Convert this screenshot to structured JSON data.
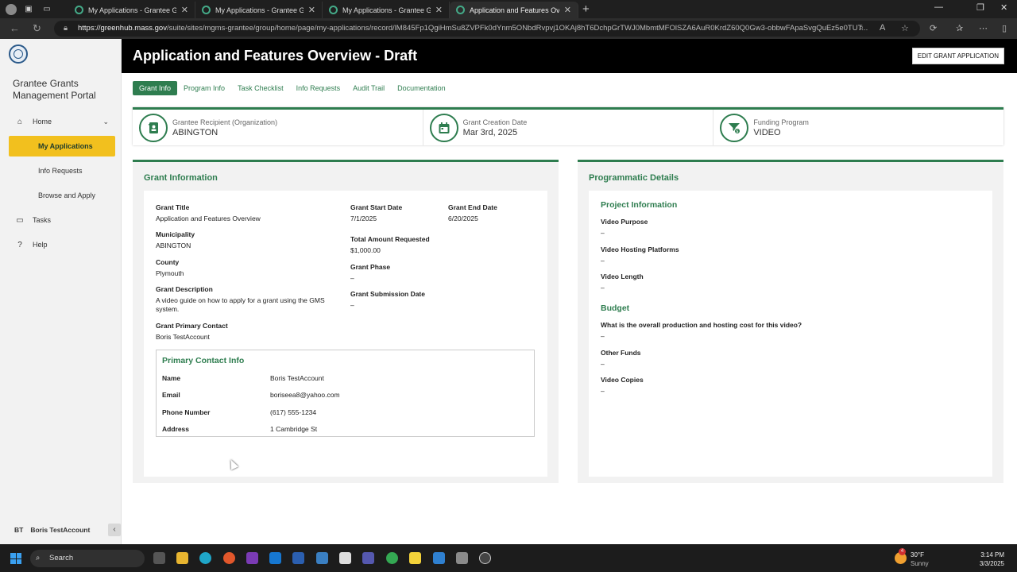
{
  "browser": {
    "tabs": [
      {
        "title": "My Applications - Grantee Grants"
      },
      {
        "title": "My Applications - Grantee Grants"
      },
      {
        "title": "My Applications - Grantee Grants"
      },
      {
        "title": "Application and Features Overview"
      }
    ],
    "url_host": "https://greenhub.mass.gov",
    "url_path": "/suite/sites/mgms-grantee/group/home/page/my-applications/record/lM845Fp1QgiHmSu8ZVPFk0dYnm5ONbdRvpvj1OKAj8hT6DchpGrTWJ0MbmtMFOlSZA6AuR0KrdZ60Q0Gw3-obbwFApaSvgQuEz5e0TUT..."
  },
  "sidebar": {
    "portal_title": "Grantee Grants Management Portal",
    "items": [
      {
        "label": "Home"
      },
      {
        "label": "My Applications"
      },
      {
        "label": "Info Requests"
      },
      {
        "label": "Browse and Apply"
      },
      {
        "label": "Tasks"
      },
      {
        "label": "Help"
      }
    ],
    "user_initials": "BT",
    "user_name": "Boris TestAccount"
  },
  "header": {
    "title": "Application and Features Overview - Draft",
    "edit_button": "EDIT GRANT APPLICATION"
  },
  "tabs": [
    "Grant Info",
    "Program Info",
    "Task Checklist",
    "Info Requests",
    "Audit Trail",
    "Documentation"
  ],
  "summary": {
    "recipient_label": "Grantee Recipient (Organization)",
    "recipient_value": "ABINGTON",
    "creation_label": "Grant Creation Date",
    "creation_value": "Mar 3rd, 2025",
    "program_label": "Funding Program",
    "program_value": "VIDEO"
  },
  "grant_info": {
    "heading": "Grant Information",
    "title_label": "Grant Title",
    "title_value": "Application and Features Overview",
    "municipality_label": "Municipality",
    "municipality_value": "ABINGTON",
    "county_label": "County",
    "county_value": "Plymouth",
    "description_label": "Grant Description",
    "description_value": "A video guide on how to apply for a grant using the GMS system.",
    "primary_contact_label": "Grant Primary Contact",
    "primary_contact_value": "Boris TestAccount",
    "start_label": "Grant Start Date",
    "start_value": "7/1/2025",
    "end_label": "Grant End Date",
    "end_value": "6/20/2025",
    "amount_label": "Total Amount Requested",
    "amount_value": "$1,000.00",
    "phase_label": "Grant Phase",
    "phase_value": "–",
    "submission_label": "Grant Submission Date",
    "submission_value": "–",
    "contact_box": {
      "title": "Primary Contact Info",
      "name_label": "Name",
      "name_value": "Boris TestAccount",
      "email_label": "Email",
      "email_value": "boriseea8@yahoo.com",
      "phone_label": "Phone Number",
      "phone_value": "(617) 555-1234",
      "address_label": "Address",
      "address_value": "1 Cambridge St"
    }
  },
  "programmatic": {
    "heading": "Programmatic Details",
    "project_heading": "Project Information",
    "purpose_label": "Video Purpose",
    "purpose_value": "–",
    "platforms_label": "Video Hosting Platforms",
    "platforms_value": "–",
    "length_label": "Video Length",
    "length_value": "–",
    "budget_heading": "Budget",
    "cost_label": "What is the overall production and hosting cost for this video?",
    "cost_value": "–",
    "other_funds_label": "Other Funds",
    "other_funds_value": "–",
    "copies_label": "Video Copies",
    "copies_value": "–"
  },
  "taskbar": {
    "search": "Search",
    "weather_temp": "30°F",
    "weather_desc": "Sunny",
    "time": "3:14 PM",
    "date": "3/3/2025",
    "notification_count": "4"
  },
  "colors": {
    "accent": "#2e7d4f",
    "highlight": "#f2c01e",
    "header": "#000000"
  }
}
